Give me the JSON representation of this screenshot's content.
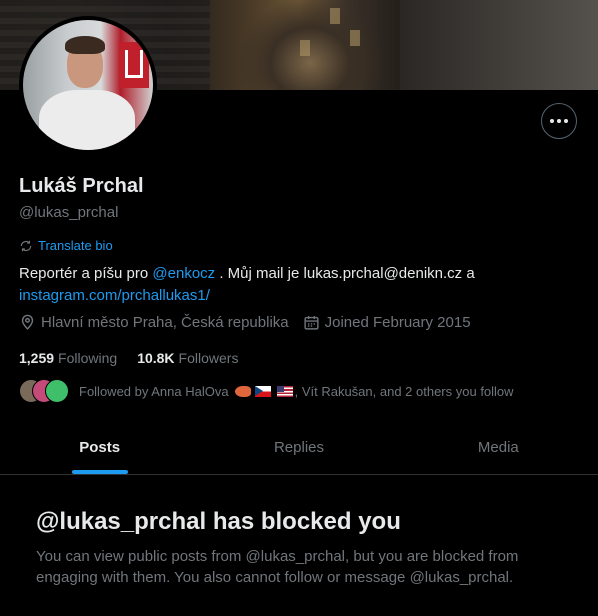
{
  "profile": {
    "name": "Lukáš Prchal",
    "handle": "@lukas_prchal",
    "translate_label": "Translate bio",
    "bio": {
      "part1": "Reportér a píšu pro ",
      "mention": "@enkocz",
      "part2": " . Můj mail je lukas.prchal@denikn.cz a ",
      "link": "instagram.com/prchallukas1/"
    },
    "location": "Hlavní město Praha, Česká republika",
    "joined": "Joined February 2015",
    "following_count": "1,259",
    "following_label": "Following",
    "followers_count": "10.8K",
    "followers_label": "Followers",
    "followed_by": {
      "prefix": "Followed by Anna HalOva",
      "suffix": ", Vít Rakušan, and 2 others you follow"
    }
  },
  "tabs": [
    {
      "label": "Posts",
      "active": true
    },
    {
      "label": "Replies",
      "active": false
    },
    {
      "label": "Media",
      "active": false
    }
  ],
  "blocked": {
    "title": "@lukas_prchal has blocked you",
    "body": "You can view public posts from @lukas_prchal, but you are blocked from engaging with them. You also cannot follow or message @lukas_prchal."
  },
  "colors": {
    "accent": "#1d9bf0",
    "muted": "#71767b",
    "text": "#e7e9ea",
    "background": "#000000"
  },
  "icons": [
    "more-icon",
    "translate-icon",
    "location-icon",
    "calendar-icon"
  ]
}
